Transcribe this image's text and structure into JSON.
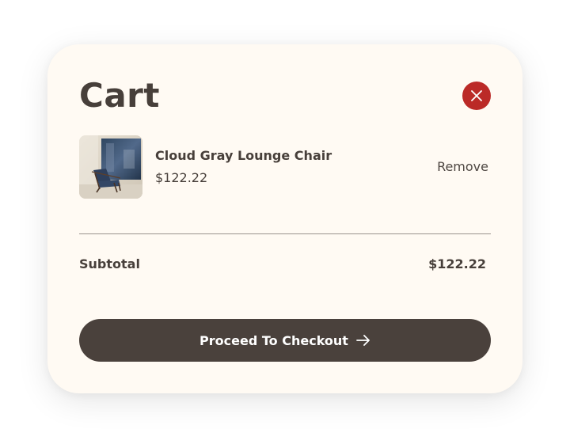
{
  "cart": {
    "title": "Cart",
    "close_icon": "close-icon",
    "items": [
      {
        "name": "Cloud Gray Lounge Chair",
        "price": "$122.22",
        "remove_label": "Remove",
        "image_icon": "lounge-chair-photo"
      }
    ],
    "subtotal_label": "Subtotal",
    "subtotal_value": "$122.22",
    "checkout_label": "Proceed To Checkout",
    "checkout_icon": "arrow-right-icon"
  },
  "colors": {
    "card_background": "#fffaf3",
    "text": "#473f3a",
    "close_button": "#bb2a27",
    "checkout_button": "#4a413c",
    "divider": "#9a938d"
  }
}
